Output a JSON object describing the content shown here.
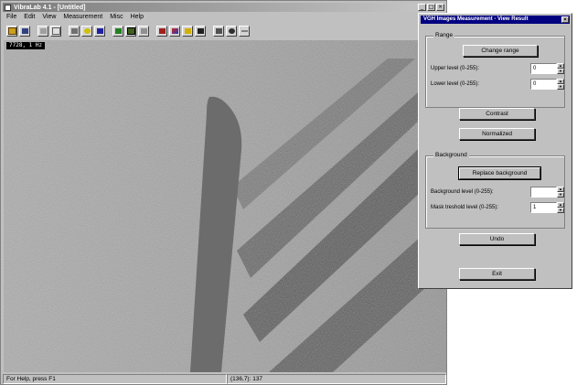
{
  "app": {
    "title": "VibraLab 4.1 - [Untitled]",
    "window_buttons": [
      "_",
      "□",
      "×"
    ]
  },
  "menu": {
    "items": [
      "File",
      "Edit",
      "View",
      "Measurement",
      "Misc",
      "Help"
    ]
  },
  "toolbar": {
    "icons": [
      "open-icon",
      "save-icon",
      "cut-icon",
      "copy-icon",
      "print-icon",
      "help-icon",
      "pointer-help-icon",
      "frame-icon",
      "capture-icon",
      "camera-icon",
      "histogram-icon",
      "graph-icon",
      "folder-graph-icon",
      "color-icon",
      "crosshair-icon",
      "target-icon",
      "line-icon"
    ]
  },
  "image": {
    "coordinate_label": "7728, 1 Hz"
  },
  "status": {
    "help_text": "For Help, press F1",
    "position_readout": "(136,7): 137"
  },
  "dialog": {
    "title": "VGH Images Measurement - View Result",
    "close_label": "×",
    "range_group": {
      "label": "Range",
      "change_range": "Change range",
      "upper_label": "Upper level (0-255):",
      "upper_value": "0",
      "lower_label": "Lower level (0-255):",
      "lower_value": "0"
    },
    "contrast_button": "Contrast",
    "normalized_button": "Normalized",
    "background_group": {
      "label": "Background",
      "replace_background": "Replace background",
      "bg_level_label": "Background level (0-255):",
      "bg_level_value": "",
      "mask_label": "Mask treshold level (0-255):",
      "mask_value": "1"
    },
    "undo_button": "Undo",
    "exit_button": "Exit"
  },
  "colors": {
    "dialog_title_bg": "#000080",
    "window_face": "#c0c0c0",
    "image_gray": "#8e8e8e",
    "stripe_dark": "#2e2e2e"
  }
}
